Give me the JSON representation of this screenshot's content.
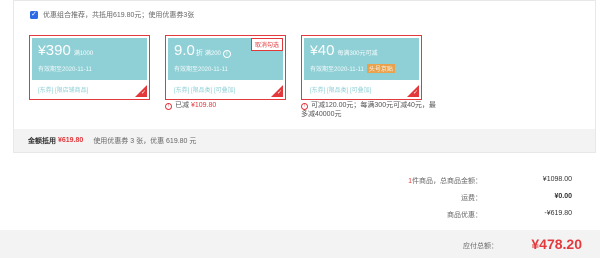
{
  "combo": {
    "checked": true,
    "text": "优惠组合推荐，共抵用619.80元；使用优惠券3张"
  },
  "coupons": [
    {
      "currency": "¥",
      "amount": "390",
      "unit": "",
      "condition": "满1000",
      "valid": "有效期至2020-11-11",
      "tags": "[东券]  [限店铺商品]",
      "badge": "",
      "cancel": "",
      "note_prefix": "",
      "note_text": "",
      "note_value": ""
    },
    {
      "currency": "",
      "amount": "9.0",
      "unit": "折",
      "condition": "满200",
      "valid": "有效期至2020-11-11",
      "tags": "[东券]  [限品类]  [可叠加]",
      "badge": "",
      "cancel": "取消勾选",
      "note_prefix": "已减",
      "note_value": "¥109.80",
      "note_text": ""
    },
    {
      "currency": "¥",
      "amount": "40",
      "unit": "",
      "condition": "每满300元可减",
      "valid": "有效期至2020-11-11",
      "tags": "[东券]  [限品类]  [可叠加]",
      "badge": "头号京贴",
      "cancel": "",
      "note_prefix": "",
      "note_value": "",
      "note_text": "可减120.00元；每满300元可减40元，最多减40000元"
    }
  ],
  "deduct": {
    "label": "金额抵用",
    "value": "¥619.80",
    "desc": "使用优惠券 3 张，优惠 619.80 元"
  },
  "summary": {
    "items_count": "1",
    "items_label": "件商品，总商品金额：",
    "items_amount": "¥1098.00",
    "shipping_label": "运费：",
    "shipping_amount": "¥0.00",
    "discount_label": "商品优惠：",
    "discount_amount": "-¥619.80"
  },
  "payable": {
    "label": "应付总额：",
    "amount": "¥478.20"
  },
  "colors": {
    "accent_red": "#e3393c",
    "coupon_teal": "#8fd0d6",
    "checkbox_blue": "#2d6be4",
    "badge_orange": "#f39c3c"
  }
}
